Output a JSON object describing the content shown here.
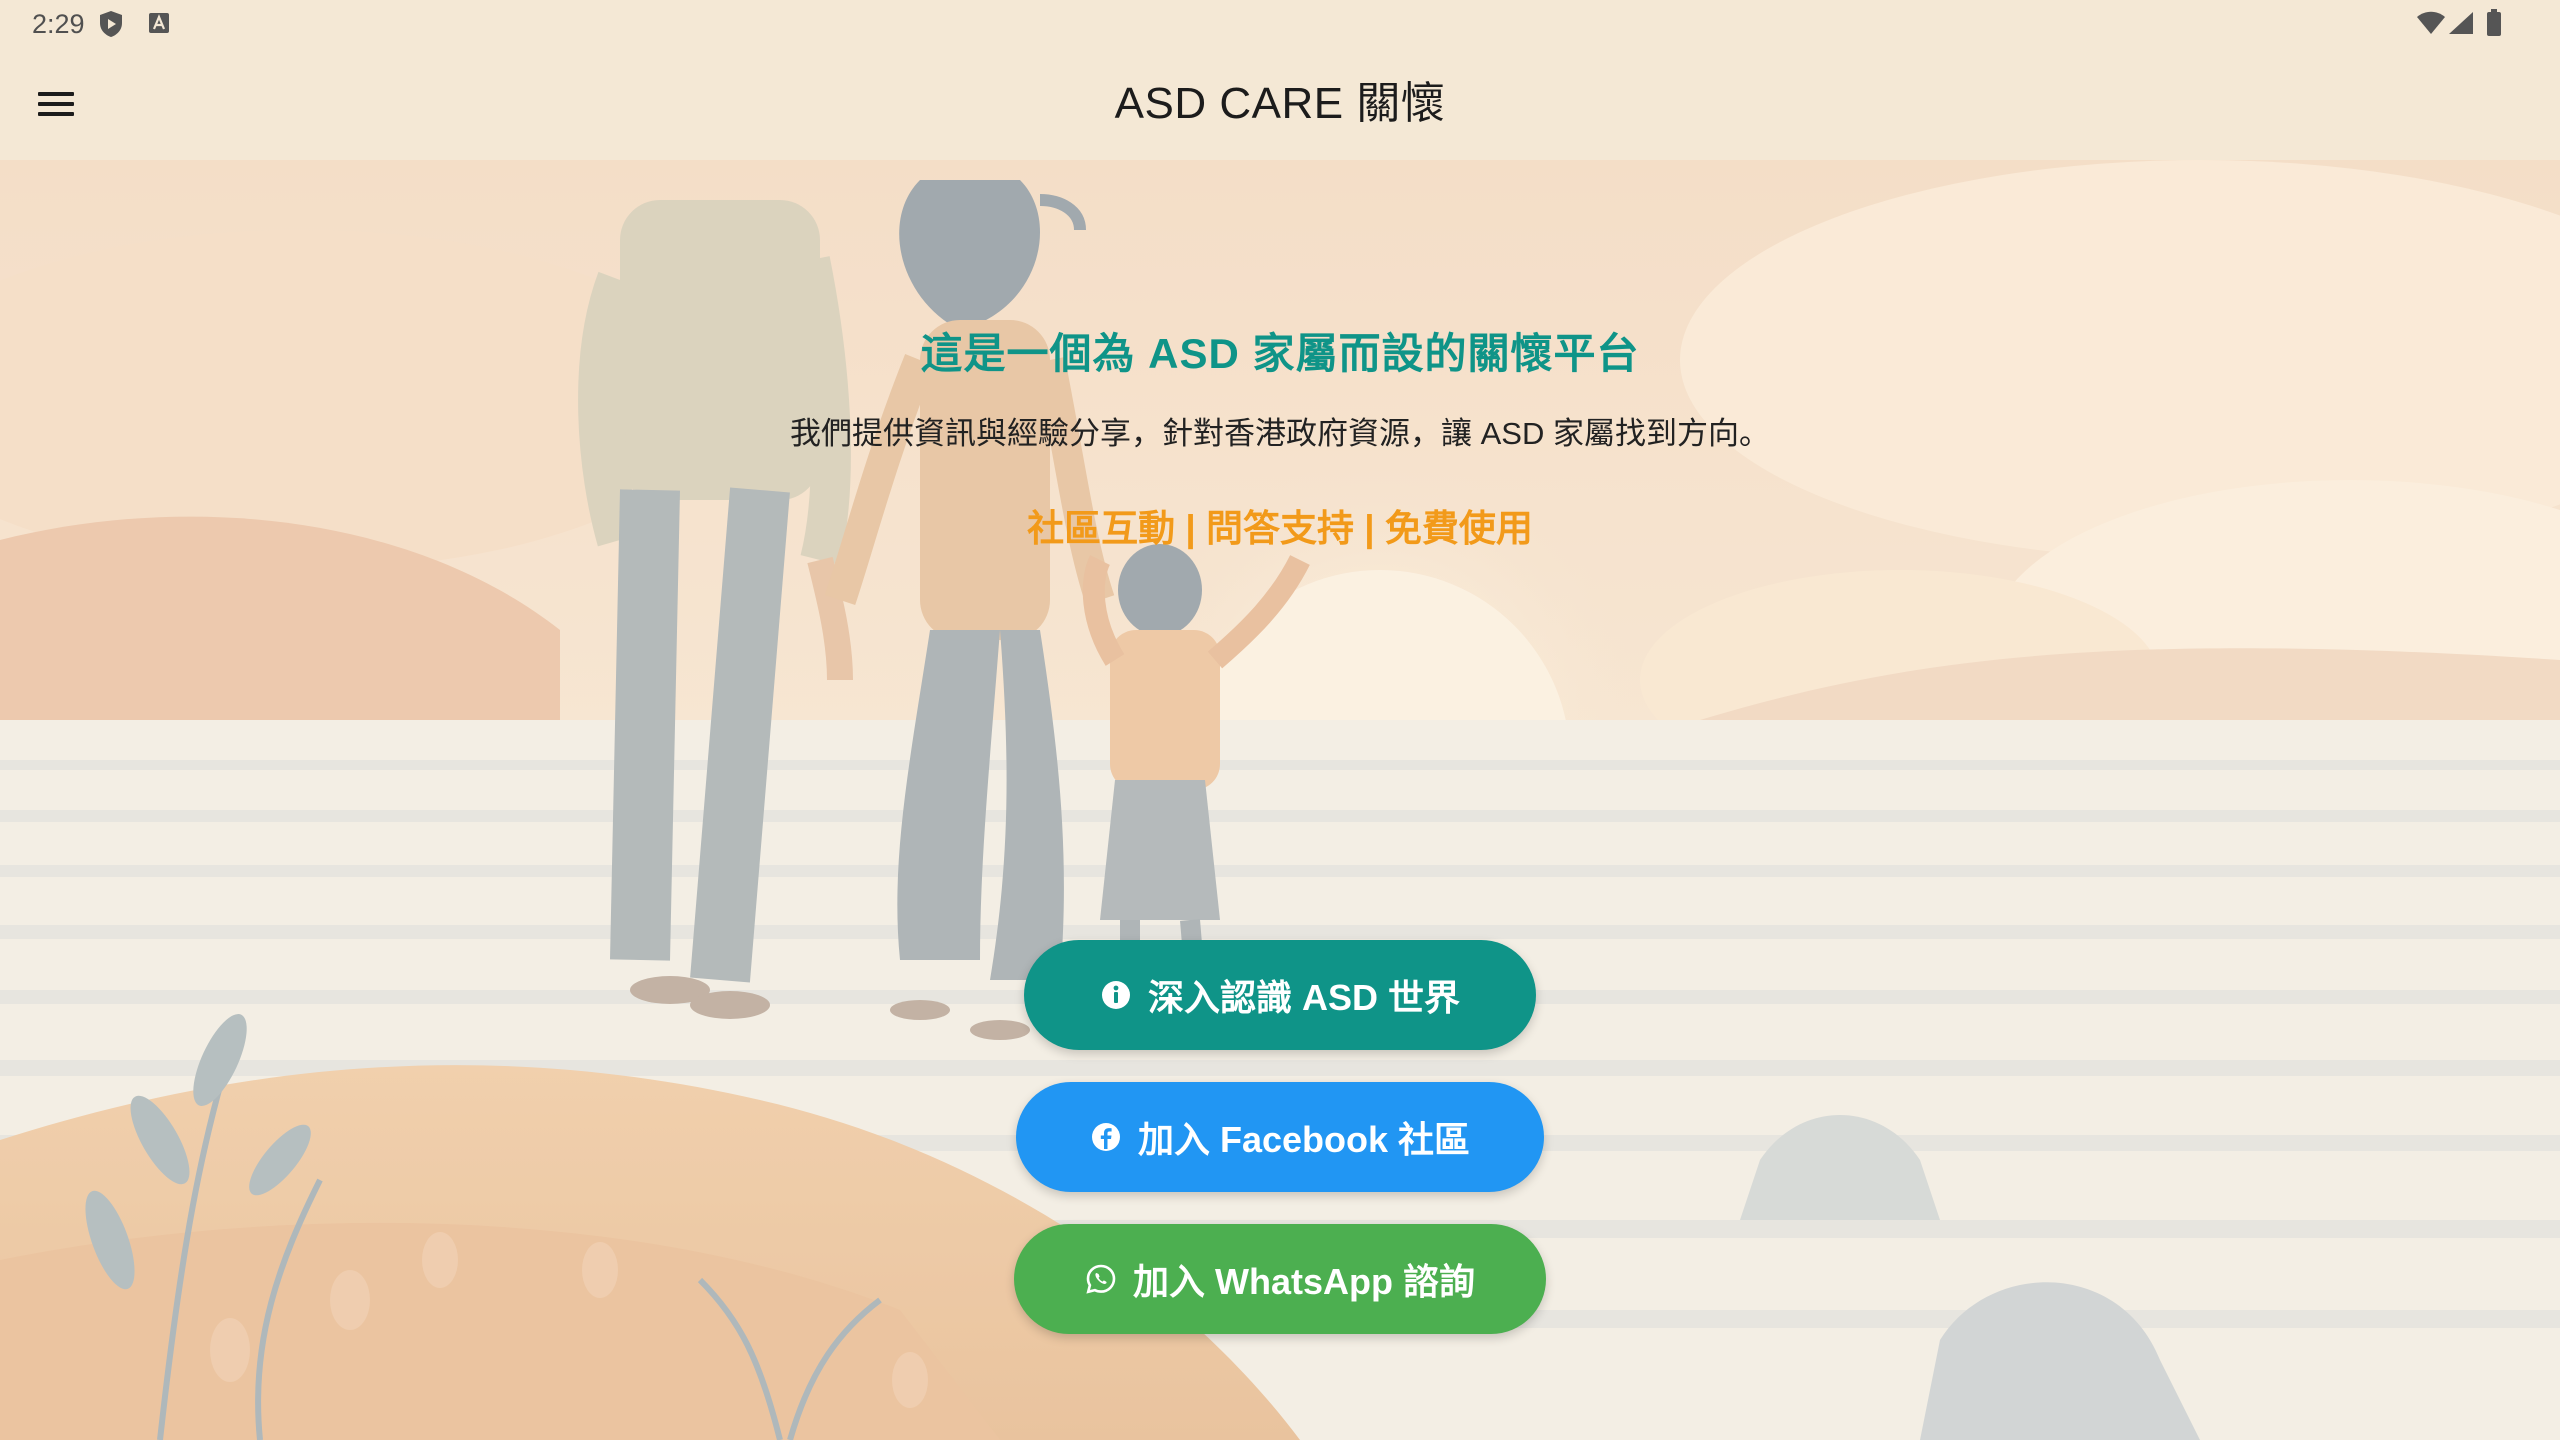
{
  "status_bar": {
    "time": "2:29",
    "icons": [
      "shield-play-icon",
      "a-badge-icon",
      "wifi-icon",
      "signal-icon",
      "battery-icon"
    ]
  },
  "app_bar": {
    "title": "ASD CARE 關懷",
    "menu_icon": "hamburger-menu-icon"
  },
  "hero": {
    "headline": "這是一個為 ASD 家屬而設的關懷平台",
    "description": "我們提供資訊與經驗分享，針對香港政府資源，讓 ASD 家屬找到方向。",
    "tagline": "社區互動 | 問答支持 | 免費使用",
    "illustration": "family-on-hill-illustration"
  },
  "actions": {
    "learn": {
      "label": "深入認識 ASD 世界",
      "icon": "info-icon",
      "color": "#0f9488"
    },
    "facebook": {
      "label": "加入 Facebook 社區",
      "icon": "facebook-icon",
      "color": "#2196f3"
    },
    "whatsapp": {
      "label": "加入 WhatsApp 諮詢",
      "icon": "whatsapp-icon",
      "color": "#4caf50"
    }
  },
  "colors": {
    "headline": "#0f9488",
    "tagline": "#f29a1a",
    "app_bar_bg": "#f4e8d5"
  }
}
